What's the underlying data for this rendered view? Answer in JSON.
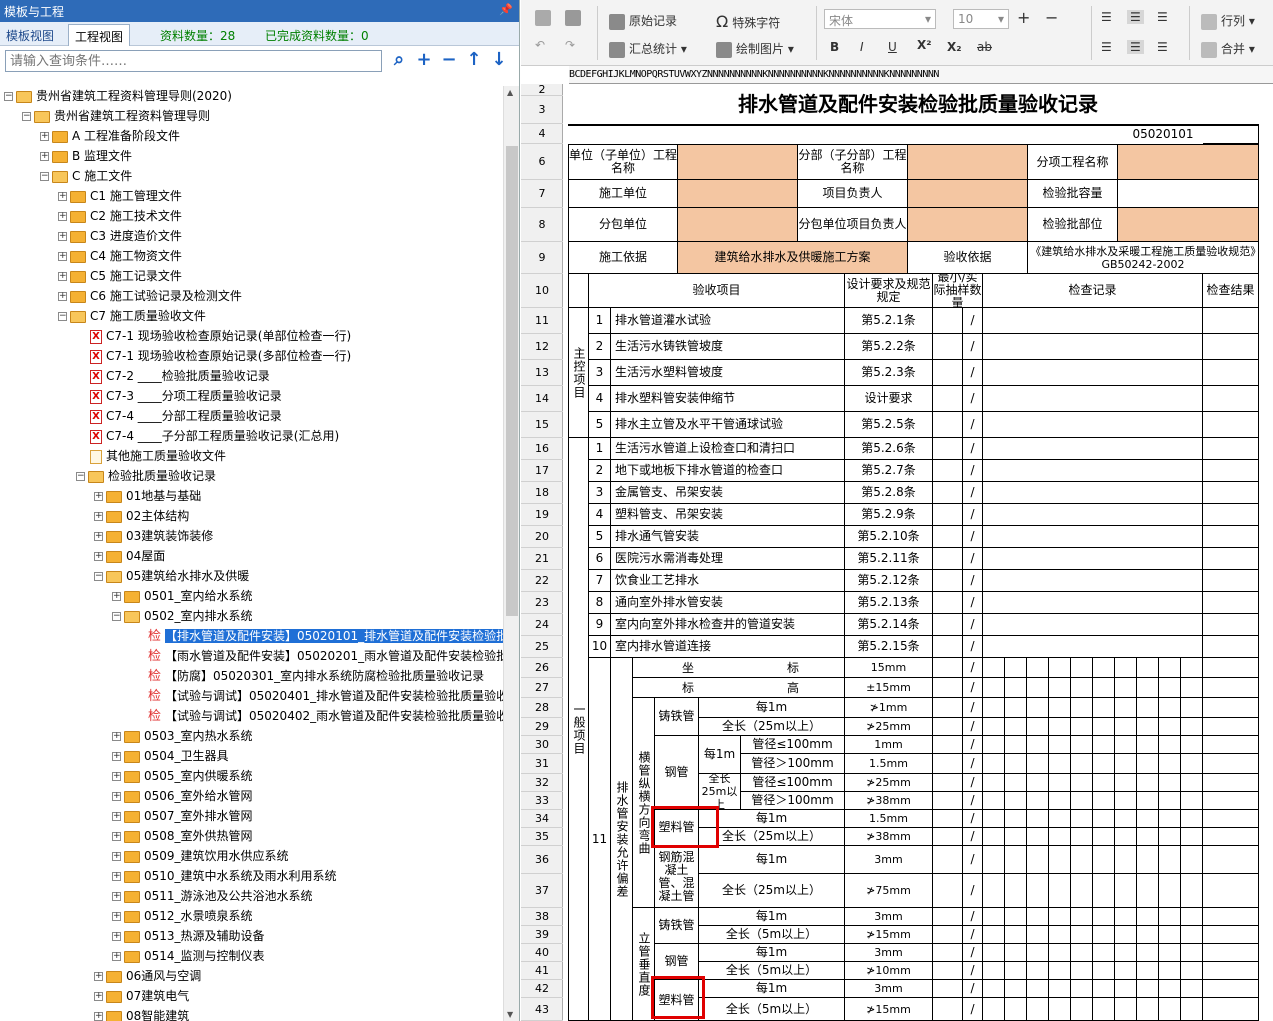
{
  "left_panel": {
    "title": "模板与工程",
    "pin_icon": "pin-icon",
    "tabs": [
      "模板视图",
      "工程视图"
    ],
    "material_count_label": "资料数量：28",
    "completed_count_label": "已完成资料数量：0",
    "search_placeholder": "请输入查询条件……",
    "tree": [
      {
        "level": 0,
        "kind": "folder",
        "open": true,
        "label": "贵州省建筑工程资料管理导则(2020)"
      },
      {
        "level": 1,
        "kind": "folder",
        "open": true,
        "label": "贵州省建筑工程资料管理导则"
      },
      {
        "level": 2,
        "kind": "folder",
        "open": false,
        "label": "A 工程准备阶段文件"
      },
      {
        "level": 2,
        "kind": "folder",
        "open": false,
        "label": "B 监理文件"
      },
      {
        "level": 2,
        "kind": "folder",
        "open": true,
        "label": "C 施工文件"
      },
      {
        "level": 3,
        "kind": "folder",
        "open": false,
        "label": "C1 施工管理文件"
      },
      {
        "level": 3,
        "kind": "folder",
        "open": false,
        "label": "C2 施工技术文件"
      },
      {
        "level": 3,
        "kind": "folder",
        "open": false,
        "label": "C3 进度造价文件"
      },
      {
        "level": 3,
        "kind": "folder",
        "open": false,
        "label": "C4 施工物资文件"
      },
      {
        "level": 3,
        "kind": "folder",
        "open": false,
        "label": "C5 施工记录文件"
      },
      {
        "level": 3,
        "kind": "folder",
        "open": false,
        "label": "C6 施工试验记录及检测文件"
      },
      {
        "level": 3,
        "kind": "folder",
        "open": true,
        "label": "C7 施工质量验收文件"
      },
      {
        "level": 4,
        "kind": "xls",
        "label": "C7-1 现场验收检查原始记录(单部位检查一行)"
      },
      {
        "level": 4,
        "kind": "xls",
        "label": "C7-1 现场验收检查原始记录(多部位检查一行)"
      },
      {
        "level": 4,
        "kind": "xls",
        "label": "C7-2 ____检验批质量验收记录"
      },
      {
        "level": 4,
        "kind": "xls",
        "label": "C7-3 ____分项工程质量验收记录"
      },
      {
        "level": 4,
        "kind": "xls",
        "label": "C7-4 ____分部工程质量验收记录"
      },
      {
        "level": 4,
        "kind": "xls",
        "label": "C7-4 ____子分部工程质量验收记录(汇总用)"
      },
      {
        "level": 4,
        "kind": "doc",
        "label": "其他施工质量验收文件"
      },
      {
        "level": 4,
        "kind": "folder",
        "open": true,
        "label": "检验批质量验收记录"
      },
      {
        "level": 5,
        "kind": "folder",
        "open": false,
        "label": "01地基与基础"
      },
      {
        "level": 5,
        "kind": "folder",
        "open": false,
        "label": "02主体结构"
      },
      {
        "level": 5,
        "kind": "folder",
        "open": false,
        "label": "03建筑装饰装修"
      },
      {
        "level": 5,
        "kind": "folder",
        "open": false,
        "label": "04屋面"
      },
      {
        "level": 5,
        "kind": "folder",
        "open": true,
        "label": "05建筑给水排水及供暖"
      },
      {
        "level": 6,
        "kind": "folder",
        "open": false,
        "label": "0501_室内给水系统"
      },
      {
        "level": 6,
        "kind": "folder",
        "open": true,
        "label": "0502_室内排水系统"
      },
      {
        "level": 7,
        "kind": "jian",
        "selected": true,
        "label": "【排水管道及配件安装】05020101_排水管道及配件安装检验批"
      },
      {
        "level": 7,
        "kind": "jian",
        "label": "【雨水管道及配件安装】05020201_雨水管道及配件安装检验批"
      },
      {
        "level": 7,
        "kind": "jian",
        "label": "【防腐】05020301_室内排水系统防腐检验批质量验收记录"
      },
      {
        "level": 7,
        "kind": "jian",
        "label": "【试验与调试】05020401_排水管道及配件安装检验批质量验收"
      },
      {
        "level": 7,
        "kind": "jian",
        "label": "【试验与调试】05020402_雨水管道及配件安装检验批质量验收"
      },
      {
        "level": 6,
        "kind": "folder",
        "open": false,
        "label": "0503_室内热水系统"
      },
      {
        "level": 6,
        "kind": "folder",
        "open": false,
        "label": "0504_卫生器具"
      },
      {
        "level": 6,
        "kind": "folder",
        "open": false,
        "label": "0505_室内供暖系统"
      },
      {
        "level": 6,
        "kind": "folder",
        "open": false,
        "label": "0506_室外给水管网"
      },
      {
        "level": 6,
        "kind": "folder",
        "open": false,
        "label": "0507_室外排水管网"
      },
      {
        "level": 6,
        "kind": "folder",
        "open": false,
        "label": "0508_室外供热管网"
      },
      {
        "level": 6,
        "kind": "folder",
        "open": false,
        "label": "0509_建筑饮用水供应系统"
      },
      {
        "level": 6,
        "kind": "folder",
        "open": false,
        "label": "0510_建筑中水系统及雨水利用系统"
      },
      {
        "level": 6,
        "kind": "folder",
        "open": false,
        "label": "0511_游泳池及公共浴池水系统"
      },
      {
        "level": 6,
        "kind": "folder",
        "open": false,
        "label": "0512_水景喷泉系统"
      },
      {
        "level": 6,
        "kind": "folder",
        "open": false,
        "label": "0513_热源及辅助设备"
      },
      {
        "level": 6,
        "kind": "folder",
        "open": false,
        "label": "0514_监测与控制仪表"
      },
      {
        "level": 5,
        "kind": "folder",
        "open": false,
        "label": "06通风与空调"
      },
      {
        "level": 5,
        "kind": "folder",
        "open": false,
        "label": "07建筑电气"
      },
      {
        "level": 5,
        "kind": "folder",
        "open": false,
        "label": "08智能建筑"
      }
    ]
  },
  "toolbar": {
    "original_record": "原始记录",
    "special_char": "特殊字符",
    "summary": "汇总统计",
    "draw_picture": "绘制图片",
    "font_name": "宋体",
    "font_size": "10",
    "bold": "B",
    "italic": "I",
    "underline": "U",
    "superscript": "X²",
    "subscript": "X₂",
    "strike": "ab",
    "row_col": "行列",
    "merge": "合并"
  },
  "sheet": {
    "column_letters": "BCDEFGHIJKLMNOPQRSTUVWXYZNNNNNNNNNNKNNNNNNNNNNKNNNNNNNNNNKNNNNNNNNN",
    "row_numbers": [
      "2",
      "3",
      "4",
      "6",
      "7",
      "8",
      "9",
      "10",
      "11",
      "12",
      "13",
      "14",
      "15",
      "16",
      "17",
      "18",
      "19",
      "20",
      "21",
      "22",
      "23",
      "24",
      "25",
      "26",
      "27",
      "28",
      "29",
      "30",
      "31",
      "32",
      "33",
      "34",
      "35",
      "36",
      "37",
      "38",
      "39",
      "40",
      "41",
      "42",
      "43"
    ],
    "title": "排水管道及配件安装检验批质量验收记录",
    "code": "05020101",
    "header": {
      "unit_project": "单位（子单位）工程名称",
      "sub_project": "分部（子分部）工程名称",
      "item_project": "分项工程名称",
      "construction_unit": "施工单位",
      "project_manager": "项目负责人",
      "batch_capacity": "检验批容量",
      "subcontractor": "分包单位",
      "sub_project_manager": "分包单位项目负责人",
      "batch_location": "检验批部位",
      "construction_basis_label": "施工依据",
      "construction_basis": "建筑给水排水及供暖施工方案",
      "acceptance_basis_label": "验收依据",
      "acceptance_basis": "《建筑给水排水及采暖工程施工质量验收规范》GB50242-2002"
    },
    "col_headers": {
      "item": "验收项目",
      "design": "设计要求及规范规定",
      "sample": "最小/实际抽样数量",
      "record": "检查记录",
      "result": "检查结果"
    },
    "main_label": "主控项目",
    "general_label": "一般项目",
    "main_items": [
      {
        "no": "1",
        "name": "排水管道灌水试验",
        "spec": "第5.2.1条"
      },
      {
        "no": "2",
        "name": "生活污水铸铁管坡度",
        "spec": "第5.2.2条"
      },
      {
        "no": "3",
        "name": "生活污水塑料管坡度",
        "spec": "第5.2.3条"
      },
      {
        "no": "4",
        "name": "排水塑料管安装伸缩节",
        "spec": "设计要求"
      },
      {
        "no": "5",
        "name": "排水主立管及水平干管通球试验",
        "spec": "第5.2.5条"
      }
    ],
    "general_items": [
      {
        "no": "1",
        "name": "生活污水管道上设检查口和清扫口",
        "spec": "第5.2.6条"
      },
      {
        "no": "2",
        "name": "地下或地板下排水管道的检查口",
        "spec": "第5.2.7条"
      },
      {
        "no": "3",
        "name": "金属管支、吊架安装",
        "spec": "第5.2.8条"
      },
      {
        "no": "4",
        "name": "塑料管支、吊架安装",
        "spec": "第5.2.9条"
      },
      {
        "no": "5",
        "name": "排水通气管安装",
        "spec": "第5.2.10条"
      },
      {
        "no": "6",
        "name": "医院污水需消毒处理",
        "spec": "第5.2.11条"
      },
      {
        "no": "7",
        "name": "饮食业工艺排水",
        "spec": "第5.2.12条"
      },
      {
        "no": "8",
        "name": "通向室外排水管安装",
        "spec": "第5.2.13条"
      },
      {
        "no": "9",
        "name": "室内向室外排水检查井的管道安装",
        "spec": "第5.2.14条"
      },
      {
        "no": "10",
        "name": "室内排水管道连接",
        "spec": "第5.2.15条"
      }
    ],
    "slash": "/",
    "item11_no": "11",
    "item11_label": "排水管安装允许偏差",
    "horizontal_label": "横管纵横方向弯曲",
    "vertical_label": "立管垂直度",
    "coord": {
      "name": "坐",
      "name2": "标",
      "val": "15mm"
    },
    "elev": {
      "name": "标",
      "name2": "高",
      "val": "±15mm"
    },
    "cast_iron": "铸铁管",
    "steel": "钢管",
    "plastic": "塑料管",
    "rc_pipe": "钢筋混凝土管、混凝土管",
    "per_1m": "每1m",
    "total_25": "全长（25m以上）",
    "total_25b": "全长25m以上",
    "total_5": "全长（5m以上）",
    "d_le_100": "管径≤100mm",
    "d_gt_100": "管径＞100mm",
    "vals": {
      "r28": "≯1mm",
      "r29": "≯25mm",
      "r30": "1mm",
      "r31": "1.5mm",
      "r32": "≯25mm",
      "r33": "≯38mm",
      "r34": "1.5mm",
      "r35": "≯38mm",
      "r36": "3mm",
      "r37": "≯75mm",
      "r38": "3mm",
      "r39": "≯15mm",
      "r40": "3mm",
      "r41": "≯10mm",
      "r42": "3mm",
      "r43": "≯15mm"
    }
  }
}
